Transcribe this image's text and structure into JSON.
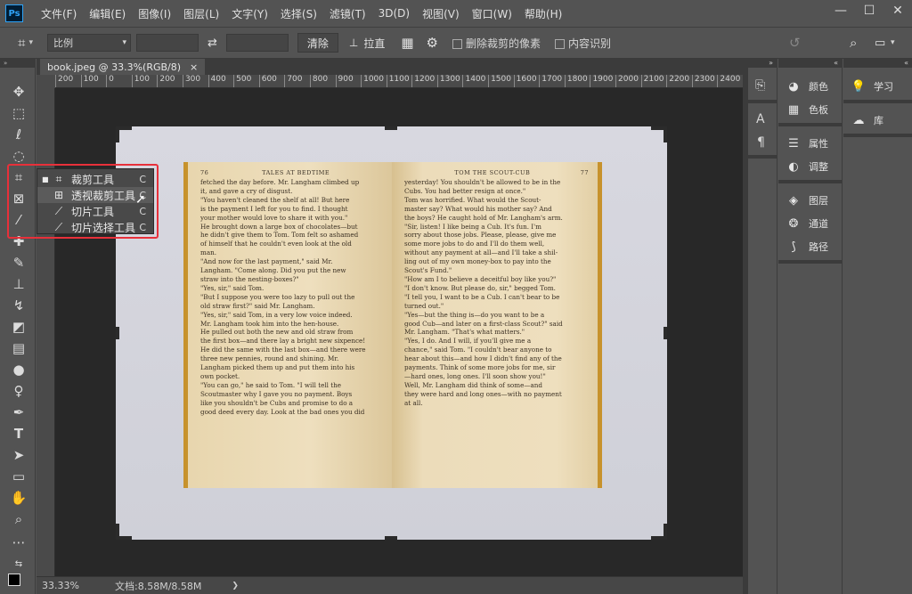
{
  "app": {
    "logo": "Ps",
    "menus": [
      "文件(F)",
      "编辑(E)",
      "图像(I)",
      "图层(L)",
      "文字(Y)",
      "选择(S)",
      "滤镜(T)",
      "3D(D)",
      "视图(V)",
      "窗口(W)",
      "帮助(H)"
    ],
    "window_controls": [
      "—",
      "☐",
      "✕"
    ]
  },
  "options": {
    "ratio_select": "比例",
    "clear_label": "清除",
    "straighten_label": "拉直",
    "delete_cropped_label": "删除裁剪的像素",
    "content_aware_label": "内容识别"
  },
  "document": {
    "tab_title": "book.jpeg @ 33.3%(RGB/8)",
    "tab_close": "×",
    "ruler_ticks": [
      "200",
      "100",
      "0",
      "100",
      "200",
      "300",
      "400",
      "500",
      "600",
      "700",
      "800",
      "900",
      "1000",
      "1100",
      "1200",
      "1300",
      "1400",
      "1500",
      "1600",
      "1700",
      "1800",
      "1900",
      "2000",
      "2100",
      "2200",
      "2300",
      "2400"
    ]
  },
  "flyout": {
    "items": [
      {
        "label": "裁剪工具",
        "shortcut": "C",
        "icon": "crop-icon"
      },
      {
        "label": "透视裁剪工具",
        "shortcut": "C",
        "icon": "perspective-crop-icon"
      },
      {
        "label": "切片工具",
        "shortcut": "C",
        "icon": "slice-icon"
      },
      {
        "label": "切片选择工具",
        "shortcut": "C",
        "icon": "slice-select-icon"
      }
    ]
  },
  "panels": {
    "col2": [
      "颜色",
      "色板",
      "属性",
      "调整",
      "图层",
      "通道",
      "路径"
    ],
    "col3": [
      "学习",
      "库"
    ]
  },
  "book": {
    "left_page_number": "76",
    "left_header": "TALES AT BEDTIME",
    "right_header": "TOM THE SCOUT-CUB",
    "right_page_number": "77",
    "left_text": "fetched the day before. Mr. Langham climbed up\nit, and gave a cry of disgust.\n\"You haven't cleaned the shelf at all! But here\nis the payment I left for you to find. I thought\nyour mother would love to share it with you.\"\nHe brought down a large box of chocolates—but\nhe didn't give them to Tom. Tom felt so ashamed\nof himself that he couldn't even look at the old\nman.\n\"And now for the last payment,\" said Mr.\nLangham. \"Come along. Did you put the new\nstraw into the nesting-boxes?\"\n\"Yes, sir,\" said Tom.\n\"But I suppose you were too lazy to pull out the\nold straw first?\" said Mr. Langham.\n\"Yes, sir,\" said Tom, in a very low voice indeed.\nMr. Langham took him into the hen-house.\nHe pulled out both the new and old straw from\nthe first box—and there lay a bright new sixpence!\nHe did the same with the last box—and there were\nthree new pennies, round and shining. Mr.\nLangham picked them up and put them into his\nown pocket.\n\"You can go,\" he said to Tom. \"I will tell the\nScoutmaster why I gave you no payment. Boys\nlike you shouldn't be Cubs and promise to do a\ngood deed every day. Look at the bad ones you did",
    "right_text": "yesterday! You shouldn't be allowed to be in the\nCubs. You had better resign at once.\"\nTom was horrified. What would the Scout-\nmaster say? What would his mother say? And\nthe boys? He caught hold of Mr. Langham's arm.\n\"Sir, listen! I like being a Cub. It's fun. I'm\nsorry about those jobs. Please, please, give me\nsome more jobs to do and I'll do them well,\nwithout any payment at all—and I'll take a shil-\nling out of my own money-box to pay into the\nScout's Fund.\"\n\"How am I to believe a deceitful boy like you?\"\n\"I don't know. But please do, sir,\" begged Tom.\n\"I tell you, I want to be a Cub. I can't bear to be\nturned out.\"\n\"Yes—but the thing is—do you want to be a\ngood Cub—and later on a first-class Scout?\" said\nMr. Langham. \"That's what matters.\"\n\"Yes, I do. And I will, if you'll give me a\nchance,\" said Tom. \"I couldn't bear anyone to\nhear about this—and how I didn't find any of the\npayments. Think of some more jobs for me, sir\n—hard ones, long ones. I'll soon show you!\"\nWell, Mr. Langham did think of some—and\nthey were hard and long ones—with no payment\nat all."
  },
  "status": {
    "zoom": "33.33%",
    "doc_info": "文档:8.58M/8.58M",
    "arrow": "❯"
  },
  "colors": {
    "accent": "#2fa3f7",
    "highlight_box": "#e8303a",
    "book_cover": "#c7922c"
  }
}
